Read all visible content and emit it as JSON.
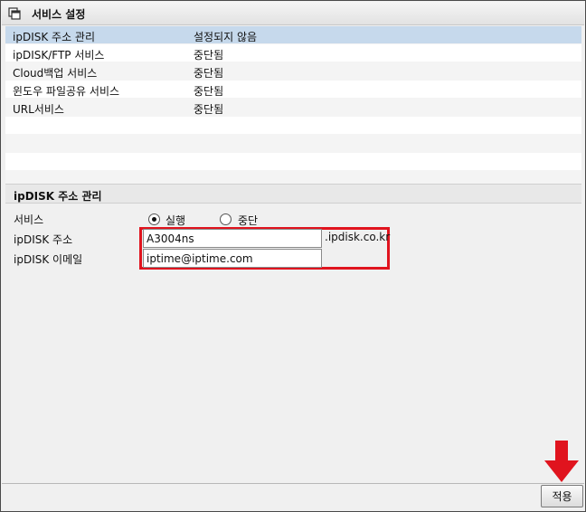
{
  "header": {
    "title": "서비스 설정",
    "icon": "window-stack-icon"
  },
  "services": [
    {
      "name": "ipDISK 주소 관리",
      "status": "설정되지 않음",
      "selected": true
    },
    {
      "name": "ipDISK/FTP 서비스",
      "status": "중단됨",
      "selected": false
    },
    {
      "name": "Cloud백업 서비스",
      "status": "중단됨",
      "selected": false
    },
    {
      "name": "윈도우 파일공유 서비스",
      "status": "중단됨",
      "selected": false
    },
    {
      "name": "URL서비스",
      "status": "중단됨",
      "selected": false
    }
  ],
  "section": {
    "title": "ipDISK 주소 관리"
  },
  "form": {
    "service_label": "서비스",
    "run_label": "실행",
    "stop_label": "중단",
    "service_selected": "실행",
    "address_label": "ipDISK 주소",
    "address_value": "A3004ns",
    "domain_suffix": ".ipdisk.co.kr",
    "email_label": "ipDISK 이메일",
    "email_value": "iptime@iptime.com"
  },
  "apply_label": "적용",
  "colors": {
    "highlight": "#e0141e",
    "selected_row": "#c6d9ec",
    "arrow": "#e0141e"
  }
}
